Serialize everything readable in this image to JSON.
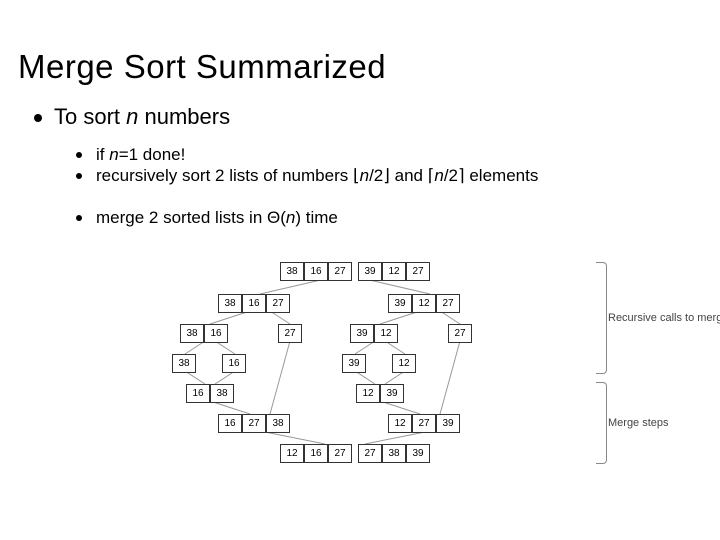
{
  "title": "Merge Sort Summarized",
  "main": {
    "text_pre": "To sort ",
    "text_var": "n",
    "text_post": " numbers"
  },
  "sub": [
    {
      "pre": "if ",
      "var": "n",
      "post": "=1 done!"
    },
    {
      "pre": "recursively sort 2 lists of numbers ⌊",
      "var1": "n",
      "mid": "/2⌋ and ⌈",
      "var2": "n",
      "post": "/2⌉ elements"
    },
    {
      "pre": "merge 2 sorted lists in Θ(",
      "var": "n",
      "post": ") time"
    }
  ],
  "diagram": {
    "r0": [
      "38",
      "16",
      "27",
      "39",
      "12",
      "27"
    ],
    "r1a": [
      "38",
      "16",
      "27"
    ],
    "r1b": [
      "39",
      "12",
      "27"
    ],
    "r2a": [
      "38",
      "16"
    ],
    "r2b": [
      "27"
    ],
    "r2c": [
      "39",
      "12"
    ],
    "r2d": [
      "27"
    ],
    "r3a": [
      "38"
    ],
    "r3b": [
      "16"
    ],
    "r3c": [
      "39"
    ],
    "r3d": [
      "12"
    ],
    "r4a": [
      "16",
      "38"
    ],
    "r4b": [
      "12",
      "39"
    ],
    "r5a": [
      "16",
      "27",
      "38"
    ],
    "r5b": [
      "12",
      "27",
      "39"
    ],
    "r6": [
      "12",
      "16",
      "27",
      "27",
      "38",
      "39"
    ],
    "label1": "Recursive calls to mergesort",
    "label2": "Merge steps"
  }
}
